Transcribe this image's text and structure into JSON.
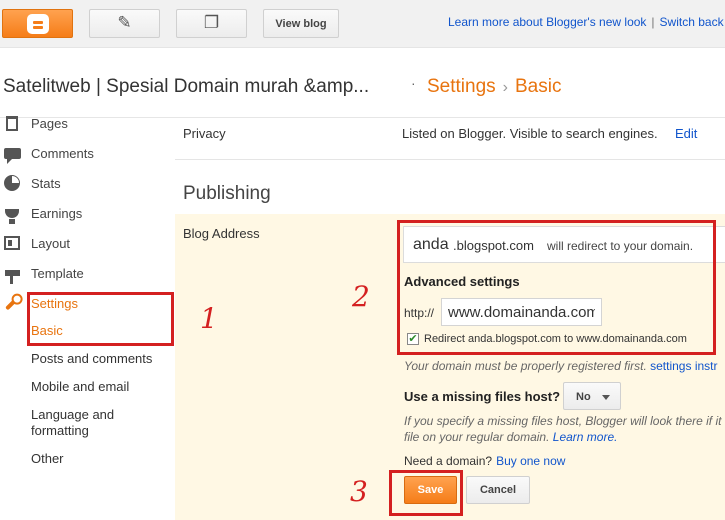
{
  "toolbar": {
    "view_blog_label": "View blog",
    "learn_more_link": "Learn more about Blogger's new look",
    "separator": "|",
    "switch_back_link": "Switch back",
    "icons": {
      "blogger": "blogger-logo-icon",
      "edit": "pencil-icon",
      "posts": "documents-icon"
    }
  },
  "header": {
    "blog_title": "Satelitweb | Spesial Domain murah &amp...",
    "dot": "·",
    "breadcrumb_section": "Settings",
    "breadcrumb_arrow": "›",
    "breadcrumb_page": "Basic"
  },
  "sidebar": {
    "items": [
      {
        "label": "Pages",
        "icon": "pages-icon"
      },
      {
        "label": "Comments",
        "icon": "comments-icon"
      },
      {
        "label": "Stats",
        "icon": "pie-chart-icon"
      },
      {
        "label": "Earnings",
        "icon": "trophy-icon"
      },
      {
        "label": "Layout",
        "icon": "layout-icon"
      },
      {
        "label": "Template",
        "icon": "paint-roller-icon"
      },
      {
        "label": "Settings",
        "icon": "wrench-icon",
        "active": true
      }
    ],
    "sub_items": [
      "Basic",
      "Posts and comments",
      "Mobile and email",
      "Language and formatting",
      "Other"
    ]
  },
  "privacy": {
    "label": "Privacy",
    "value": "Listed on Blogger. Visible to search engines.",
    "edit_link": "Edit"
  },
  "publishing": {
    "heading": "Publishing",
    "blog_address_label": "Blog Address",
    "subdomain": "anda",
    "suffix": ".blogspot.com",
    "redirect_text": "will redirect to your domain.",
    "advanced_title": "Advanced settings",
    "http_prefix": "http://",
    "domain_value": "www.domainanda.com",
    "redirect_checkbox_label": "Redirect anda.blogspot.com to www.domainanda.com",
    "redirect_checked": true,
    "domain_note": "Your domain must be properly registered first.",
    "domain_note_link": "settings instr",
    "missing_host_label": "Use a missing files host?",
    "missing_host_value": "No",
    "missing_host_help_1": "If you specify a missing files host, Blogger will look there if it",
    "missing_host_help_2": "file on your regular domain.",
    "learn_more": "Learn more.",
    "need_domain": "Need a domain?",
    "buy_one": "Buy one now",
    "save_label": "Save",
    "cancel_label": "Cancel"
  },
  "annotations": {
    "one": "1",
    "two": "2",
    "three": "3",
    "color": "#d42020"
  },
  "colors": {
    "accent": "#e8740f",
    "link": "#1155cc",
    "panel": "#fff8e4"
  }
}
